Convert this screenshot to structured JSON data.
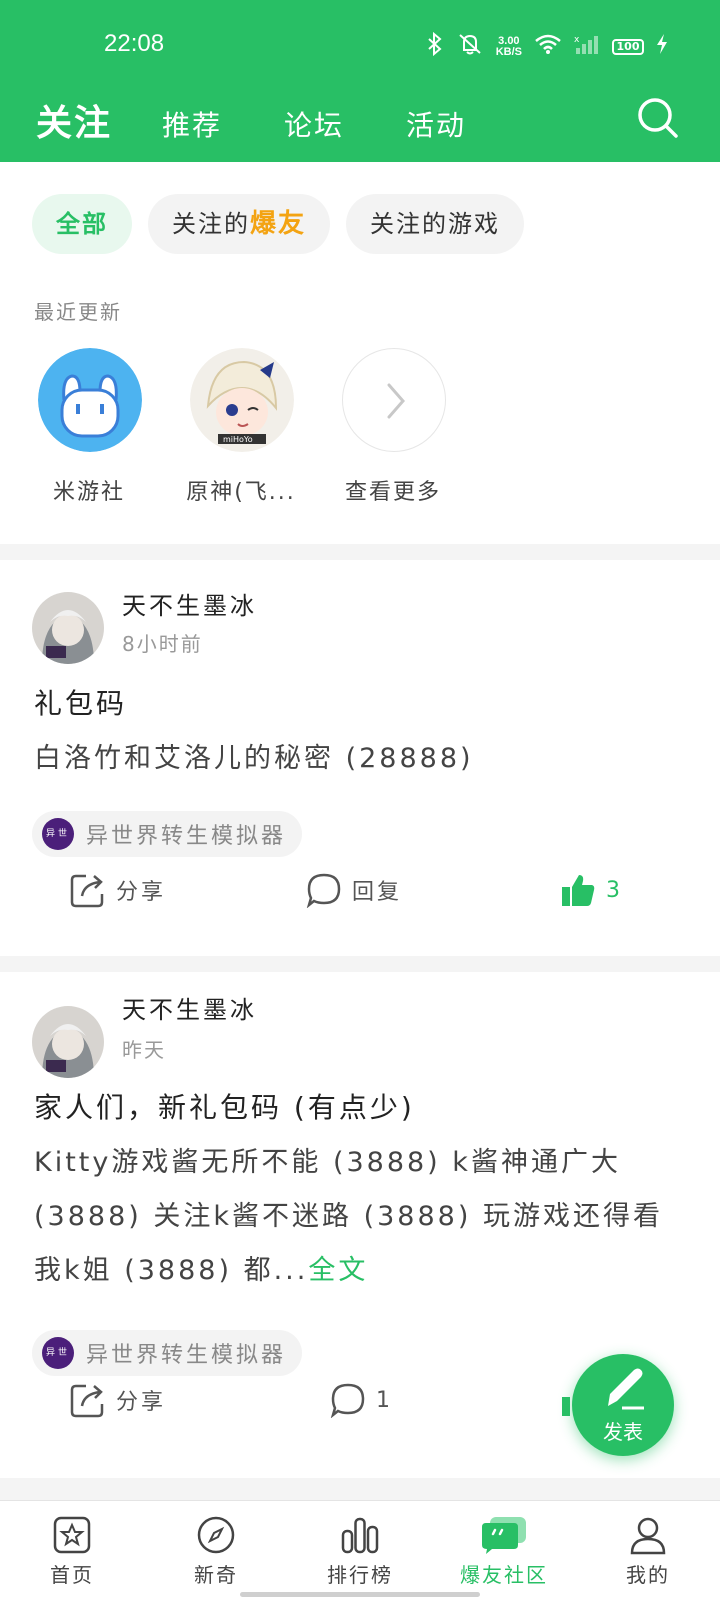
{
  "status": {
    "time": "22:08",
    "speed_value": "3.00",
    "speed_unit": "KB/S",
    "battery": "100"
  },
  "nav": {
    "tabs": [
      "关注",
      "推荐",
      "论坛",
      "活动"
    ]
  },
  "chips": {
    "all": "全部",
    "follow_friends_prefix": "关注的",
    "follow_friends_highlight": "爆友",
    "follow_games": "关注的游戏"
  },
  "recent": {
    "title": "最近更新",
    "items": [
      "米游社",
      "原神(飞...",
      "查看更多"
    ]
  },
  "posts": [
    {
      "author": "天不生墨冰",
      "time": "8小时前",
      "title": "礼包码",
      "body": "白洛竹和艾洛儿的秘密 (28888)",
      "more": "",
      "game_icon": "异世界",
      "game": "异世界转生模拟器",
      "share": "分享",
      "reply": "回复",
      "likes": "3"
    },
    {
      "author": "天不生墨冰",
      "time": "昨天",
      "title": "家人们，新礼包码 (有点少)",
      "body": "Kitty游戏酱无所不能 (3888) k酱神通广大 (3888) 关注k酱不迷路 (3888) 玩游戏还得看我k姐 (3888) 都...",
      "more": "全文",
      "game_icon": "异世界",
      "game": "异世界转生模拟器",
      "share": "分享",
      "reply": "1"
    }
  ],
  "fab": {
    "label": "发表"
  },
  "bottom_nav": [
    "首页",
    "新奇",
    "排行榜",
    "爆友社区",
    "我的"
  ],
  "colors": {
    "brand": "#28bf65",
    "highlight": "#f3a312"
  }
}
